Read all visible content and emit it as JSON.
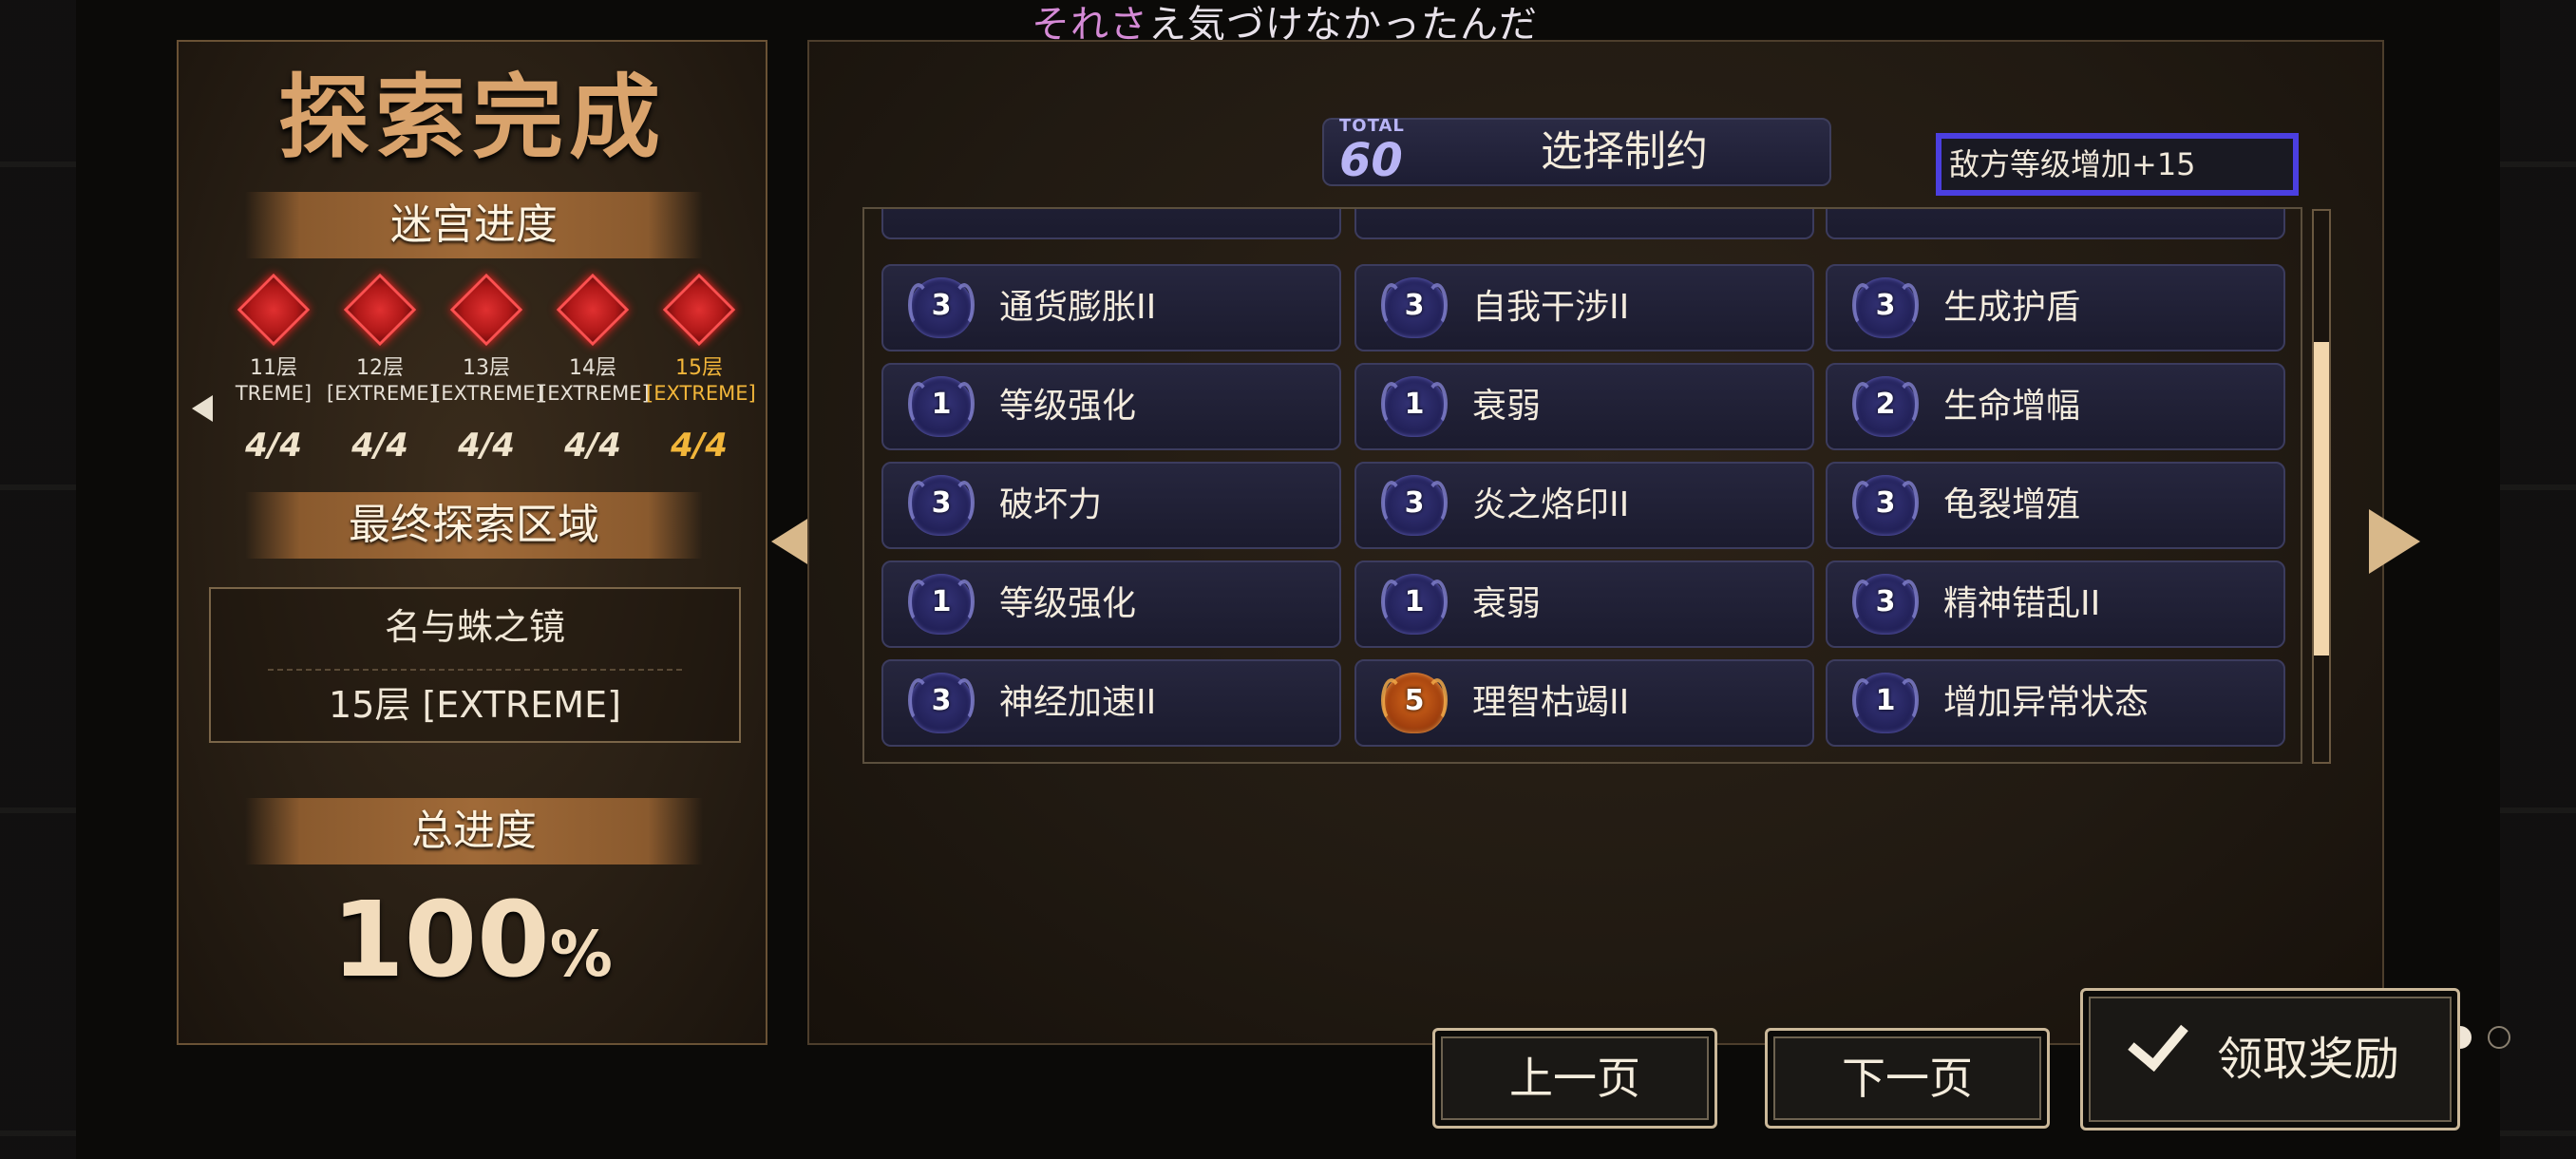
{
  "subtitle": {
    "highlight": "それさ",
    "rest": "え気づけなかったんだ"
  },
  "left": {
    "title": "探索完成",
    "labyrinth_banner": "迷宫进度",
    "floors": [
      {
        "name": "11层",
        "level": "TREME]",
        "count": "4/4",
        "current": false
      },
      {
        "name": "12层",
        "level": "[EXTREME]",
        "count": "4/4",
        "current": false
      },
      {
        "name": "13层",
        "level": "[EXTREME]",
        "count": "4/4",
        "current": false
      },
      {
        "name": "14层",
        "level": "[EXTREME]",
        "count": "4/4",
        "current": false
      },
      {
        "name": "15层",
        "level": "[EXTREME]",
        "count": "4/4",
        "current": true
      }
    ],
    "final_area_banner": "最终探索区域",
    "final_area": {
      "name": "名与蛛之镜",
      "level": "15层 [EXTREME]"
    },
    "total_banner": "总进度",
    "total_value": "100",
    "total_unit": "%"
  },
  "right": {
    "total_label": "TOTAL",
    "total_value": "60",
    "header_title": "选择制约",
    "selected_effect": "敌方等级增加+15",
    "cards": [
      {
        "level": "3",
        "label": "通货膨胀II",
        "gold": false
      },
      {
        "level": "3",
        "label": "自我干涉II",
        "gold": false
      },
      {
        "level": "3",
        "label": "生成护盾",
        "gold": false
      },
      {
        "level": "1",
        "label": "等级强化",
        "gold": false
      },
      {
        "level": "1",
        "label": "衰弱",
        "gold": false
      },
      {
        "level": "2",
        "label": "生命增幅",
        "gold": false
      },
      {
        "level": "3",
        "label": "破坏力",
        "gold": false
      },
      {
        "level": "3",
        "label": "炎之烙印II",
        "gold": false
      },
      {
        "level": "3",
        "label": "龟裂增殖",
        "gold": false
      },
      {
        "level": "1",
        "label": "等级强化",
        "gold": false
      },
      {
        "level": "1",
        "label": "衰弱",
        "gold": false
      },
      {
        "level": "3",
        "label": "精神错乱II",
        "gold": false
      },
      {
        "level": "3",
        "label": "神经加速II",
        "gold": false
      },
      {
        "level": "5",
        "label": "理智枯竭II",
        "gold": true
      },
      {
        "level": "1",
        "label": "增加异常状态",
        "gold": false
      }
    ],
    "scroll_position": 0.55,
    "page_count": 6,
    "current_page": 5,
    "prev_label": "上一页",
    "next_label": "下一页",
    "claim_label": "领取奖励"
  },
  "colors": {
    "accent_gold": "#f2b63a",
    "selection_border": "#4b3fe0",
    "panel_border": "#6a5235"
  },
  "icons": [
    "back-arrow-icon",
    "page-left-arrow-icon",
    "page-right-arrow-icon",
    "checkmark-icon",
    "restriction-shield-icon",
    "floor-diamond-icon"
  ]
}
